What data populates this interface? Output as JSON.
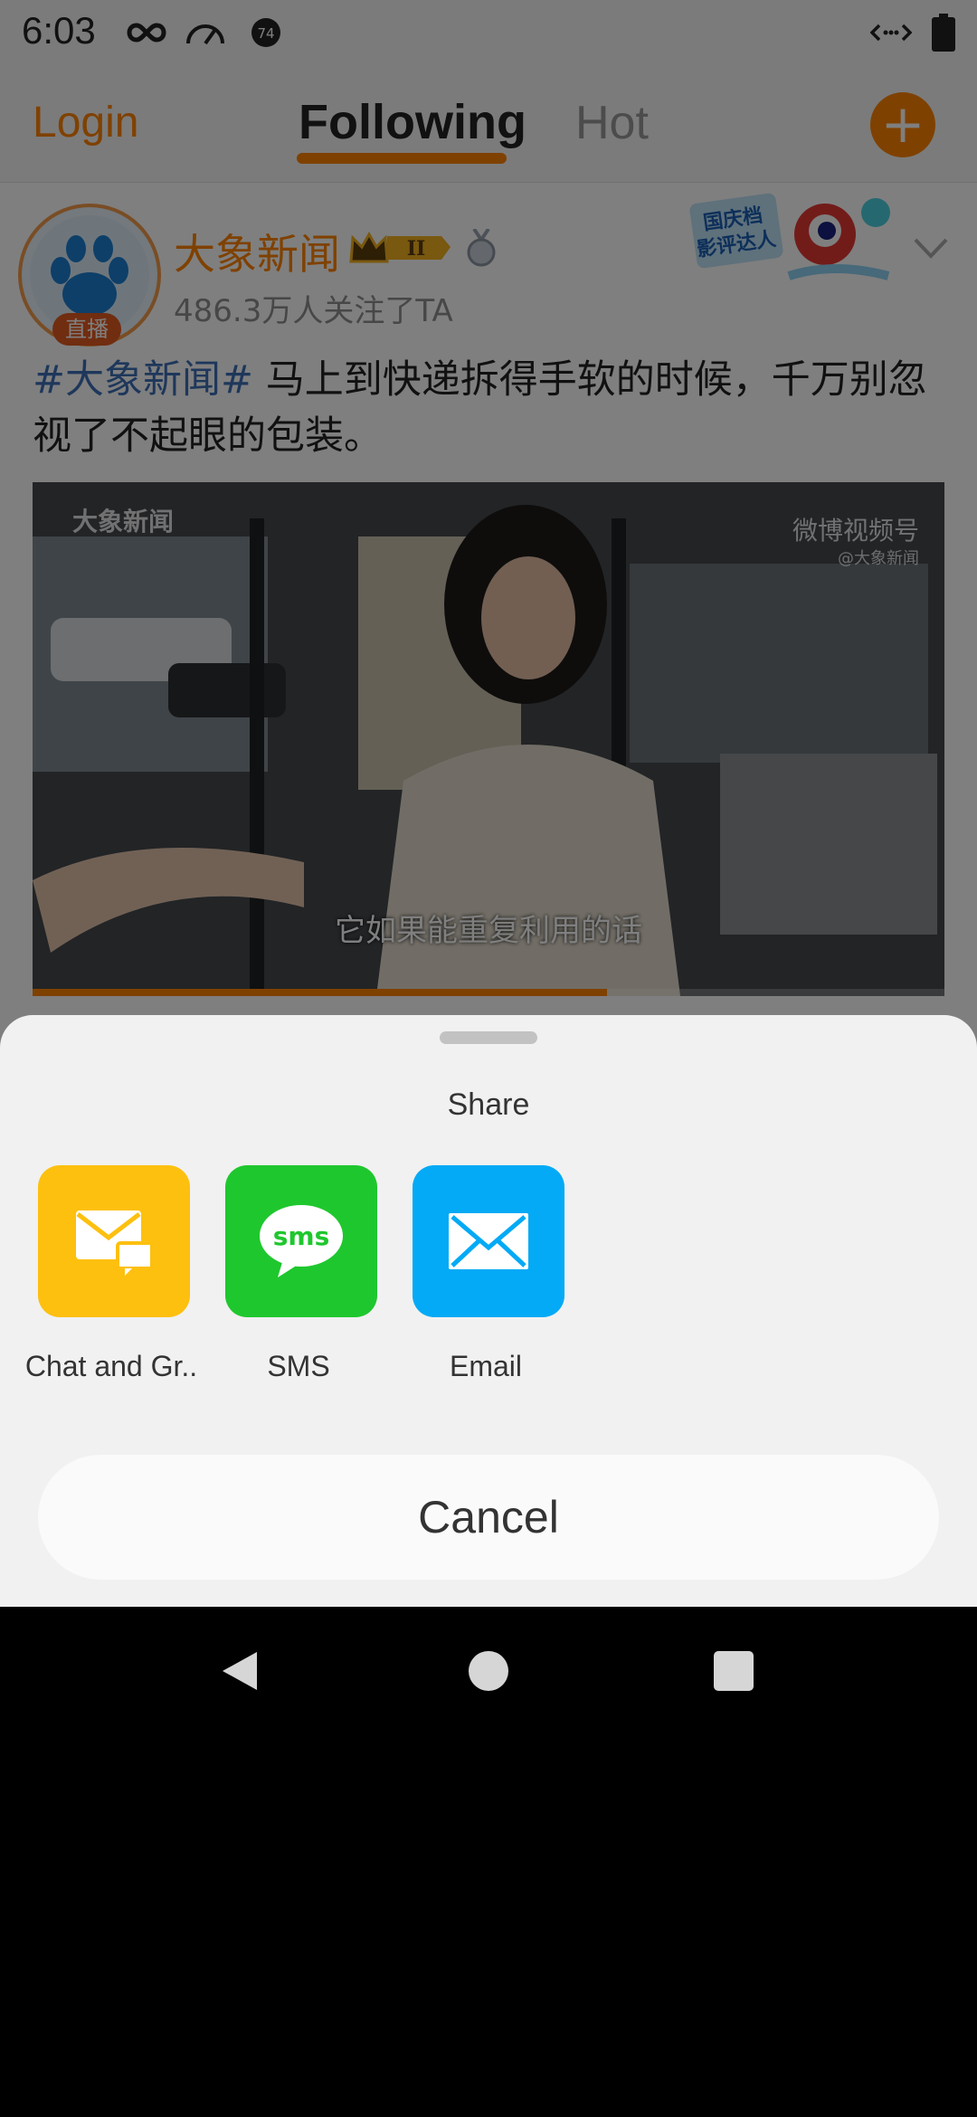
{
  "status_bar": {
    "time": "6:03",
    "icons": [
      "infinity-icon",
      "speedometer-icon",
      "notification-badge-icon",
      "data-arrows-icon",
      "battery-icon"
    ],
    "badge_number": "74"
  },
  "top_nav": {
    "login_label": "Login",
    "tabs": [
      {
        "label": "Following",
        "active": true
      },
      {
        "label": "Hot",
        "active": false
      }
    ],
    "compose_label": "+"
  },
  "post": {
    "author": "大象新闻",
    "avatar_badge": "直播",
    "crown_level": "II",
    "promo_sticker_text": [
      "国庆档",
      "影评达人"
    ],
    "followers": "486.3万人关注了TA",
    "hashtag": "#大象新闻#",
    "text": " 马上到快递拆得手软的时候，千万别忽视了不起眼的包装。",
    "video": {
      "watermark_left": "大象新闻",
      "watermark_right": "微博视频号",
      "watermark_sub": "@大象新闻",
      "subtitle": "它如果能重复利用的话",
      "progress": 0.63
    }
  },
  "share_sheet": {
    "title": "Share",
    "options": [
      {
        "label": "Chat and Gr..",
        "icon": "chat-envelope-icon",
        "color": "#fdc00f"
      },
      {
        "label": "SMS",
        "icon": "sms-bubble-icon",
        "color": "#1fc72e",
        "icon_text": "sms"
      },
      {
        "label": "Email",
        "icon": "envelope-icon",
        "color": "#04aaf5"
      }
    ],
    "cancel_label": "Cancel"
  },
  "nav_bar": {
    "buttons": [
      "back-icon",
      "home-icon",
      "recents-icon"
    ]
  },
  "colors": {
    "brand": "#ff8200",
    "hashtag": "#3d6fb6"
  }
}
